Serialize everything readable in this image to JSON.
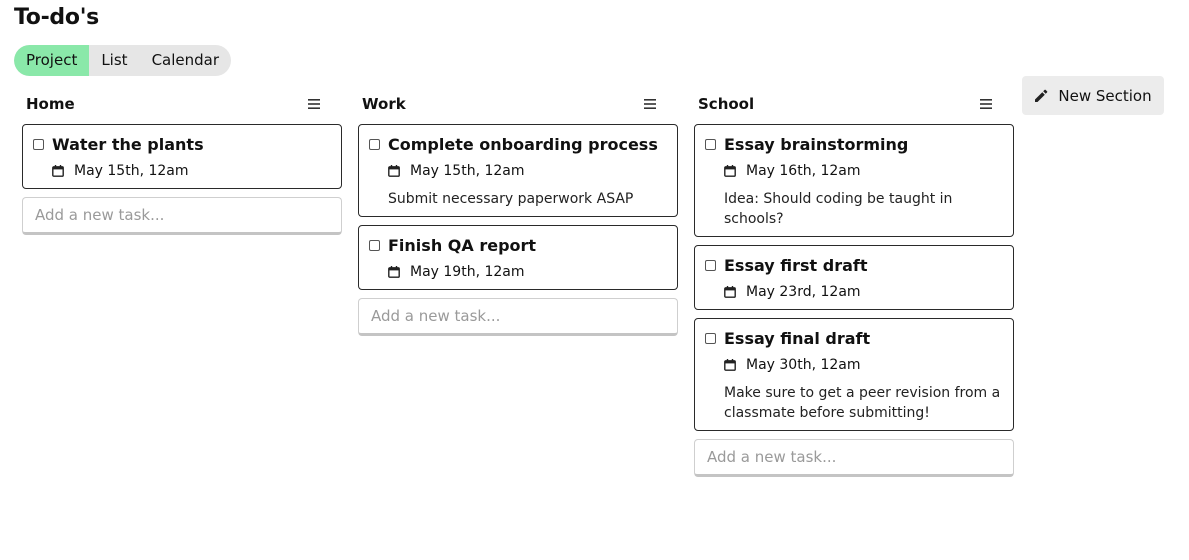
{
  "page": {
    "title": "To-do's"
  },
  "view_tabs": [
    {
      "label": "Project",
      "active": true
    },
    {
      "label": "List",
      "active": false
    },
    {
      "label": "Calendar",
      "active": false
    }
  ],
  "new_section_button": {
    "label": "New Section",
    "icon": "pencil-icon"
  },
  "colors": {
    "active_tab": "#8ae8a9",
    "tab_track": "#e6e6e6",
    "card_border": "#2a2a2a",
    "button_bg": "#ececec"
  },
  "sections": [
    {
      "title": "Home",
      "menu_icon": "menu-icon",
      "tasks": [
        {
          "title": "Water the plants",
          "date": "May 15th, 12am",
          "description": "",
          "checked": false
        }
      ],
      "add_placeholder": "Add a new task..."
    },
    {
      "title": "Work",
      "menu_icon": "menu-icon",
      "tasks": [
        {
          "title": "Complete onboarding process",
          "date": "May 15th, 12am",
          "description": "Submit necessary paperwork ASAP",
          "checked": false
        },
        {
          "title": "Finish QA report",
          "date": "May 19th, 12am",
          "description": "",
          "checked": false
        }
      ],
      "add_placeholder": "Add a new task..."
    },
    {
      "title": "School",
      "menu_icon": "menu-icon",
      "tasks": [
        {
          "title": "Essay brainstorming",
          "date": "May 16th, 12am",
          "description": "Idea: Should coding be taught in schools?",
          "checked": false
        },
        {
          "title": "Essay first draft",
          "date": "May 23rd, 12am",
          "description": "",
          "checked": false
        },
        {
          "title": "Essay final draft",
          "date": "May 30th, 12am",
          "description": "Make sure to get a peer revision from a classmate before submitting!",
          "checked": false
        }
      ],
      "add_placeholder": "Add a new task..."
    }
  ]
}
